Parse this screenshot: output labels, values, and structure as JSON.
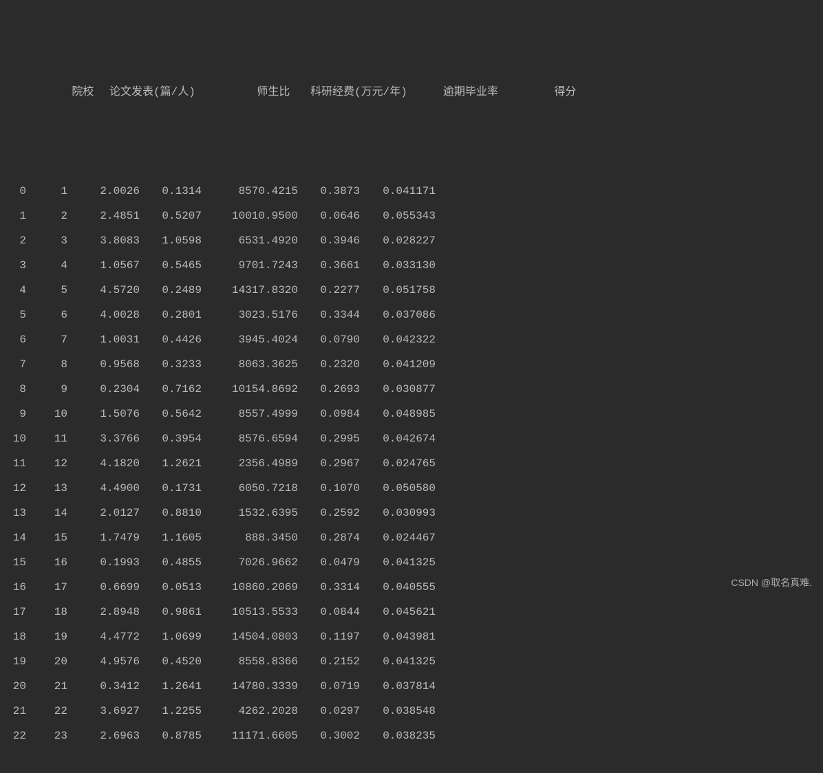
{
  "headers": {
    "idx": "",
    "col1": "院校",
    "col2": "论文发表(篇/人)",
    "col3": "师生比",
    "col4": "科研经费(万元/年)",
    "col5": "逾期毕业率",
    "col6": "得分"
  },
  "rows": [
    {
      "idx": "0",
      "c1": "1",
      "c2": "2.0026",
      "c3": "0.1314",
      "c4": "8570.4215",
      "c5": "0.3873",
      "c6": "0.041171"
    },
    {
      "idx": "1",
      "c1": "2",
      "c2": "2.4851",
      "c3": "0.5207",
      "c4": "10010.9500",
      "c5": "0.0646",
      "c6": "0.055343"
    },
    {
      "idx": "2",
      "c1": "3",
      "c2": "3.8083",
      "c3": "1.0598",
      "c4": "6531.4920",
      "c5": "0.3946",
      "c6": "0.028227"
    },
    {
      "idx": "3",
      "c1": "4",
      "c2": "1.0567",
      "c3": "0.5465",
      "c4": "9701.7243",
      "c5": "0.3661",
      "c6": "0.033130"
    },
    {
      "idx": "4",
      "c1": "5",
      "c2": "4.5720",
      "c3": "0.2489",
      "c4": "14317.8320",
      "c5": "0.2277",
      "c6": "0.051758"
    },
    {
      "idx": "5",
      "c1": "6",
      "c2": "4.0028",
      "c3": "0.2801",
      "c4": "3023.5176",
      "c5": "0.3344",
      "c6": "0.037086"
    },
    {
      "idx": "6",
      "c1": "7",
      "c2": "1.0031",
      "c3": "0.4426",
      "c4": "3945.4024",
      "c5": "0.0790",
      "c6": "0.042322"
    },
    {
      "idx": "7",
      "c1": "8",
      "c2": "0.9568",
      "c3": "0.3233",
      "c4": "8063.3625",
      "c5": "0.2320",
      "c6": "0.041209"
    },
    {
      "idx": "8",
      "c1": "9",
      "c2": "0.2304",
      "c3": "0.7162",
      "c4": "10154.8692",
      "c5": "0.2693",
      "c6": "0.030877"
    },
    {
      "idx": "9",
      "c1": "10",
      "c2": "1.5076",
      "c3": "0.5642",
      "c4": "8557.4999",
      "c5": "0.0984",
      "c6": "0.048985"
    },
    {
      "idx": "10",
      "c1": "11",
      "c2": "3.3766",
      "c3": "0.3954",
      "c4": "8576.6594",
      "c5": "0.2995",
      "c6": "0.042674"
    },
    {
      "idx": "11",
      "c1": "12",
      "c2": "4.1820",
      "c3": "1.2621",
      "c4": "2356.4989",
      "c5": "0.2967",
      "c6": "0.024765"
    },
    {
      "idx": "12",
      "c1": "13",
      "c2": "4.4900",
      "c3": "0.1731",
      "c4": "6050.7218",
      "c5": "0.1070",
      "c6": "0.050580"
    },
    {
      "idx": "13",
      "c1": "14",
      "c2": "2.0127",
      "c3": "0.8810",
      "c4": "1532.6395",
      "c5": "0.2592",
      "c6": "0.030993"
    },
    {
      "idx": "14",
      "c1": "15",
      "c2": "1.7479",
      "c3": "1.1605",
      "c4": "888.3450",
      "c5": "0.2874",
      "c6": "0.024467"
    },
    {
      "idx": "15",
      "c1": "16",
      "c2": "0.1993",
      "c3": "0.4855",
      "c4": "7026.9662",
      "c5": "0.0479",
      "c6": "0.041325"
    },
    {
      "idx": "16",
      "c1": "17",
      "c2": "0.6699",
      "c3": "0.0513",
      "c4": "10860.2069",
      "c5": "0.3314",
      "c6": "0.040555"
    },
    {
      "idx": "17",
      "c1": "18",
      "c2": "2.8948",
      "c3": "0.9861",
      "c4": "10513.5533",
      "c5": "0.0844",
      "c6": "0.045621"
    },
    {
      "idx": "18",
      "c1": "19",
      "c2": "4.4772",
      "c3": "1.0699",
      "c4": "14504.0803",
      "c5": "0.1197",
      "c6": "0.043981"
    },
    {
      "idx": "19",
      "c1": "20",
      "c2": "4.9576",
      "c3": "0.4520",
      "c4": "8558.8366",
      "c5": "0.2152",
      "c6": "0.041325"
    },
    {
      "idx": "20",
      "c1": "21",
      "c2": "0.3412",
      "c3": "1.2641",
      "c4": "14780.3339",
      "c5": "0.0719",
      "c6": "0.037814"
    },
    {
      "idx": "21",
      "c1": "22",
      "c2": "3.6927",
      "c3": "1.2255",
      "c4": "4262.2028",
      "c5": "0.0297",
      "c6": "0.038548"
    },
    {
      "idx": "22",
      "c1": "23",
      "c2": "2.6963",
      "c3": "0.8785",
      "c4": "11171.6605",
      "c5": "0.3002",
      "c6": "0.038235"
    }
  ],
  "watermark": "CSDN @取名真难."
}
